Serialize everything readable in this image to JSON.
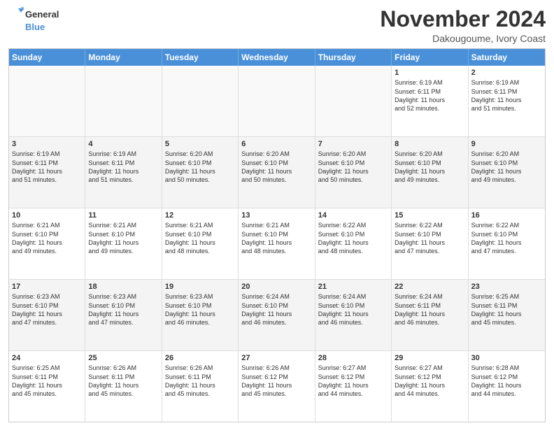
{
  "logo": {
    "line1": "General",
    "line2": "Blue"
  },
  "title": "November 2024",
  "location": "Dakougoume, Ivory Coast",
  "days_of_week": [
    "Sunday",
    "Monday",
    "Tuesday",
    "Wednesday",
    "Thursday",
    "Friday",
    "Saturday"
  ],
  "weeks": [
    [
      {
        "day": "",
        "empty": true,
        "text": ""
      },
      {
        "day": "",
        "empty": true,
        "text": ""
      },
      {
        "day": "",
        "empty": true,
        "text": ""
      },
      {
        "day": "",
        "empty": true,
        "text": ""
      },
      {
        "day": "",
        "empty": true,
        "text": ""
      },
      {
        "day": "1",
        "text": "Sunrise: 6:19 AM\nSunset: 6:11 PM\nDaylight: 11 hours\nand 52 minutes."
      },
      {
        "day": "2",
        "text": "Sunrise: 6:19 AM\nSunset: 6:11 PM\nDaylight: 11 hours\nand 51 minutes."
      }
    ],
    [
      {
        "day": "3",
        "text": "Sunrise: 6:19 AM\nSunset: 6:11 PM\nDaylight: 11 hours\nand 51 minutes."
      },
      {
        "day": "4",
        "text": "Sunrise: 6:19 AM\nSunset: 6:11 PM\nDaylight: 11 hours\nand 51 minutes."
      },
      {
        "day": "5",
        "text": "Sunrise: 6:20 AM\nSunset: 6:10 PM\nDaylight: 11 hours\nand 50 minutes."
      },
      {
        "day": "6",
        "text": "Sunrise: 6:20 AM\nSunset: 6:10 PM\nDaylight: 11 hours\nand 50 minutes."
      },
      {
        "day": "7",
        "text": "Sunrise: 6:20 AM\nSunset: 6:10 PM\nDaylight: 11 hours\nand 50 minutes."
      },
      {
        "day": "8",
        "text": "Sunrise: 6:20 AM\nSunset: 6:10 PM\nDaylight: 11 hours\nand 49 minutes."
      },
      {
        "day": "9",
        "text": "Sunrise: 6:20 AM\nSunset: 6:10 PM\nDaylight: 11 hours\nand 49 minutes."
      }
    ],
    [
      {
        "day": "10",
        "text": "Sunrise: 6:21 AM\nSunset: 6:10 PM\nDaylight: 11 hours\nand 49 minutes."
      },
      {
        "day": "11",
        "text": "Sunrise: 6:21 AM\nSunset: 6:10 PM\nDaylight: 11 hours\nand 49 minutes."
      },
      {
        "day": "12",
        "text": "Sunrise: 6:21 AM\nSunset: 6:10 PM\nDaylight: 11 hours\nand 48 minutes."
      },
      {
        "day": "13",
        "text": "Sunrise: 6:21 AM\nSunset: 6:10 PM\nDaylight: 11 hours\nand 48 minutes."
      },
      {
        "day": "14",
        "text": "Sunrise: 6:22 AM\nSunset: 6:10 PM\nDaylight: 11 hours\nand 48 minutes."
      },
      {
        "day": "15",
        "text": "Sunrise: 6:22 AM\nSunset: 6:10 PM\nDaylight: 11 hours\nand 47 minutes."
      },
      {
        "day": "16",
        "text": "Sunrise: 6:22 AM\nSunset: 6:10 PM\nDaylight: 11 hours\nand 47 minutes."
      }
    ],
    [
      {
        "day": "17",
        "text": "Sunrise: 6:23 AM\nSunset: 6:10 PM\nDaylight: 11 hours\nand 47 minutes."
      },
      {
        "day": "18",
        "text": "Sunrise: 6:23 AM\nSunset: 6:10 PM\nDaylight: 11 hours\nand 47 minutes."
      },
      {
        "day": "19",
        "text": "Sunrise: 6:23 AM\nSunset: 6:10 PM\nDaylight: 11 hours\nand 46 minutes."
      },
      {
        "day": "20",
        "text": "Sunrise: 6:24 AM\nSunset: 6:10 PM\nDaylight: 11 hours\nand 46 minutes."
      },
      {
        "day": "21",
        "text": "Sunrise: 6:24 AM\nSunset: 6:10 PM\nDaylight: 11 hours\nand 46 minutes."
      },
      {
        "day": "22",
        "text": "Sunrise: 6:24 AM\nSunset: 6:11 PM\nDaylight: 11 hours\nand 46 minutes."
      },
      {
        "day": "23",
        "text": "Sunrise: 6:25 AM\nSunset: 6:11 PM\nDaylight: 11 hours\nand 45 minutes."
      }
    ],
    [
      {
        "day": "24",
        "text": "Sunrise: 6:25 AM\nSunset: 6:11 PM\nDaylight: 11 hours\nand 45 minutes."
      },
      {
        "day": "25",
        "text": "Sunrise: 6:26 AM\nSunset: 6:11 PM\nDaylight: 11 hours\nand 45 minutes."
      },
      {
        "day": "26",
        "text": "Sunrise: 6:26 AM\nSunset: 6:11 PM\nDaylight: 11 hours\nand 45 minutes."
      },
      {
        "day": "27",
        "text": "Sunrise: 6:26 AM\nSunset: 6:12 PM\nDaylight: 11 hours\nand 45 minutes."
      },
      {
        "day": "28",
        "text": "Sunrise: 6:27 AM\nSunset: 6:12 PM\nDaylight: 11 hours\nand 44 minutes."
      },
      {
        "day": "29",
        "text": "Sunrise: 6:27 AM\nSunset: 6:12 PM\nDaylight: 11 hours\nand 44 minutes."
      },
      {
        "day": "30",
        "text": "Sunrise: 6:28 AM\nSunset: 6:12 PM\nDaylight: 11 hours\nand 44 minutes."
      }
    ]
  ]
}
